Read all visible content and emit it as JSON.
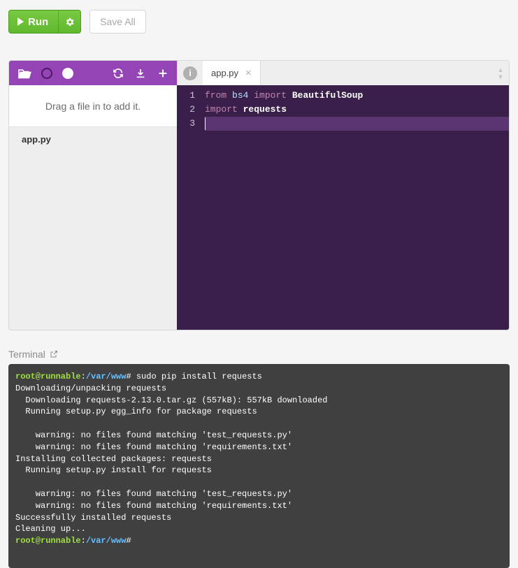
{
  "toolbar": {
    "run_label": "Run",
    "saveall_label": "Save All"
  },
  "sidebar": {
    "dropzone_text": "Drag a file in to add it.",
    "files": [
      {
        "name": "app.py"
      }
    ]
  },
  "tabs": {
    "info_label": "i",
    "open": [
      {
        "name": "app.py"
      }
    ]
  },
  "editor": {
    "line_numbers": [
      "1",
      "2",
      "3"
    ],
    "code": {
      "l1_from": "from",
      "l1_mod": "bs4",
      "l1_import": "import",
      "l1_cls": "BeautifulSoup",
      "l2_import": "import",
      "l2_mod": "requests"
    }
  },
  "terminal": {
    "label": "Terminal",
    "prompt": {
      "user": "root@runnable",
      "colon": ":",
      "path": "/var/www",
      "hash": "#"
    },
    "cmd1": " sudo pip install requests",
    "body": "Downloading/unpacking requests\n  Downloading requests-2.13.0.tar.gz (557kB): 557kB downloaded\n  Running setup.py egg_info for package requests\n\n    warning: no files found matching 'test_requests.py'\n    warning: no files found matching 'requirements.txt'\nInstalling collected packages: requests\n  Running setup.py install for requests\n\n    warning: no files found matching 'test_requests.py'\n    warning: no files found matching 'requirements.txt'\nSuccessfully installed requests\nCleaning up..."
  }
}
